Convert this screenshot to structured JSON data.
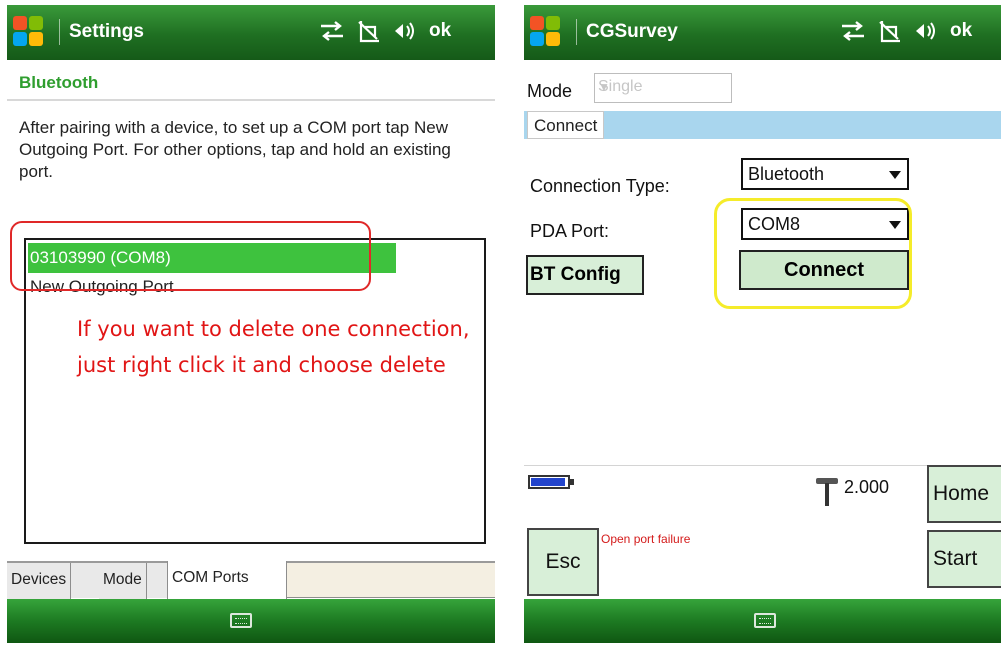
{
  "left_screen": {
    "title": "Settings",
    "ok": "ok",
    "subheader": "Bluetooth",
    "instructions": "After pairing with a device, to set up a COM port tap New Outgoing Port. For other options, tap and hold an existing port.",
    "ports": [
      "03103990 (COM8)",
      "New Outgoing Port"
    ],
    "annotation": "If you want to delete one connection, just right click it and choose delete",
    "tabs": [
      "Devices",
      "Mode",
      "COM Ports"
    ],
    "active_tab": "COM Ports"
  },
  "right_screen": {
    "title": "CGSurvey",
    "ok": "ok",
    "mode_label": "Mode",
    "mode_value": "Single",
    "connect_tab": "Connect",
    "connection_type_label": "Connection Type:",
    "connection_type_value": "Bluetooth",
    "pda_port_label": "PDA Port:",
    "pda_port_value": "COM8",
    "bt_config": "BT Config",
    "connect_button": "Connect",
    "height_value": "2.000",
    "home_button": "Home",
    "esc_button": "Esc",
    "status_message": "Open port failure",
    "start_button": "Start"
  },
  "colors": {
    "titlebar_green": "#1f6f22",
    "selected_green": "#3ec23e",
    "annotation_red": "#e11515",
    "highlight_red": "#e02828",
    "highlight_yellow": "#f5ec2a",
    "button_green": "#d8efd8"
  },
  "icons": [
    "windows-logo-icon",
    "connectivity-icon",
    "signal-off-icon",
    "volume-icon",
    "keyboard-icon",
    "battery-icon",
    "antenna-pole-icon"
  ]
}
